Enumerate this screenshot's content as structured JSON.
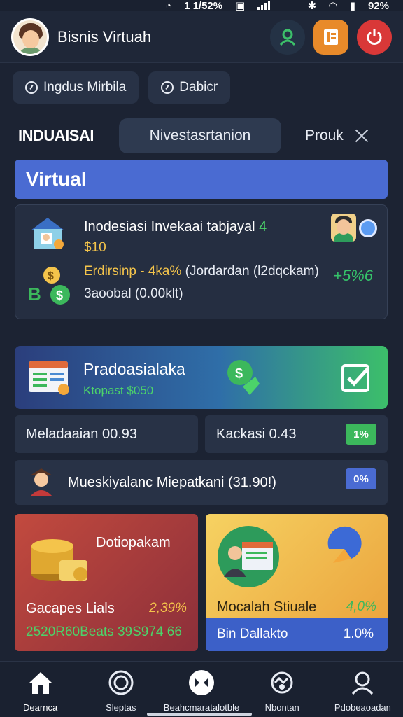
{
  "status": {
    "left": "1 1/52%",
    "right": "92%"
  },
  "header": {
    "title": "Bisnis Virtuah"
  },
  "chips": [
    {
      "label": "Ingdus Mirbila"
    },
    {
      "label": "Dabicr"
    }
  ],
  "tabs": [
    {
      "label": "INDUAISAI"
    },
    {
      "label": "Nivestasrtanion"
    },
    {
      "label": "Prouk"
    }
  ],
  "section": {
    "title": "Virtual"
  },
  "investment": {
    "title": "Inodesiasi Invekaai tabjayal",
    "title_mark": "4",
    "amount": "$10",
    "rate_prefix": "Erdirsinp - 4ka%",
    "rate_suffix": "(Jordardan (l2dqckam)",
    "balance": "3aoobal (0.00klt)",
    "change": "+5%6"
  },
  "promo": {
    "title": "Pradoasialaka",
    "subtitle": "Ktopast $050"
  },
  "stats": [
    {
      "label": "Meladaaian 00.93",
      "badge": ""
    },
    {
      "label": "Kackasi 0.43",
      "badge": "1%"
    }
  ],
  "wide": {
    "label": "Mueskiyalanc Miepatkani (31.90!)",
    "badge": "0%"
  },
  "tiles": [
    {
      "title": "Dotiopakam",
      "name": "Gacapes Lials",
      "value": "2,39%",
      "footer": "2520R60Beats 39S974 66"
    },
    {
      "title": "",
      "name": "Mocalah Stiuale",
      "value": "4,0%",
      "band_label": "Bin Dallakto",
      "band_value": "1.0%"
    }
  ],
  "nav": [
    {
      "label": "Dearnca",
      "icon": "home-icon"
    },
    {
      "label": "Sleptas",
      "icon": "coin-icon"
    },
    {
      "label": "Beahcmaratalotble",
      "icon": "dashboard-icon"
    },
    {
      "label": "Nbontan",
      "icon": "handshake-icon"
    },
    {
      "label": "Pdobeaoadan",
      "icon": "profile-icon"
    }
  ],
  "colors": {
    "accent": "#4a6bd2",
    "bg": "#1c2333",
    "green": "#3cb85c",
    "gold": "#f4c44b"
  }
}
